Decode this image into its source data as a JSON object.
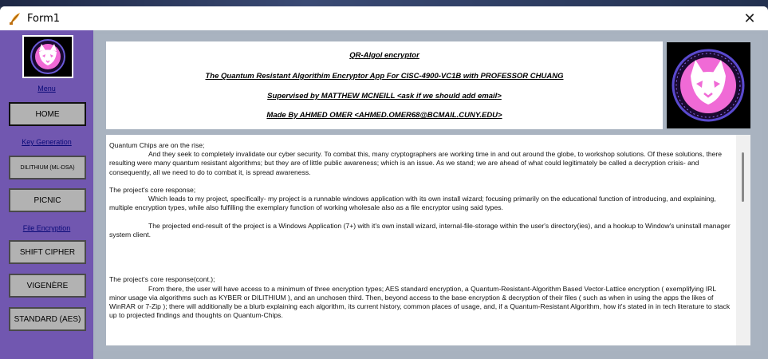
{
  "window": {
    "title": "Form1",
    "close_glyph": "✕"
  },
  "sidebar": {
    "menu_label": "Menu",
    "home_button": "HOME",
    "key_generation_label": "Key Generation",
    "dilithium_button": "DILITHIUM (ML-DSA)",
    "picnic_button": "PICNIC",
    "file_encryption_label": "File Encryption",
    "shift_cipher_button": "SHIFT CIPHER",
    "vigenere_button": "VIGENÈRE",
    "aes_button": "STANDARD (AES)"
  },
  "header": {
    "line1": "QR-Algol encryptor",
    "line2": "The Quantum Resistant Algorithim Encryptor App For CISC-4900-VC1B with PROFESSOR CHUANG",
    "line3": "Supervised by MATTHEW MCNEILL <ask if we should add email>",
    "line4": "Made By AHMED OMER <AHMED.OMER68@BCMAIL.CUNY.EDU>"
  },
  "content": {
    "p1_heading": "Quantum Chips are on the rise;",
    "p1_body": "And they seek to completely invalidate our cyber security. To combat this, many cryptographers are working time in and out around the globe, to workshop solutions. Of these solutions, there resulting were many quantum resistant algorithms; but they are of little public awareness; which is an issue. As we stand; we are ahead of what could legitimately be called a decryption crisis- and consequently, all we need to do to combat it, is spread awareness.",
    "p2_heading": "The project's core response;",
    "p2_body": "Which leads to my project, specifically- my project is a runnable windows application with its own install wizard; focusing primarily on the educational function of introducing, and explaining, multiple encryption types, while also fulfilling the exemplary function of working wholesale also as a file encryptor using said types.",
    "p3_body": "The projected end-result of the project is a Windows Application (7+) with it's own install wizard, internal-file-storage within the user's directory(ies), and a hookup to Window's uninstall manager system client.",
    "p4_heading": "The project's core response(cont.);",
    "p4_body": "From there, the user will have access to a minimum of three encryption types; AES standard encryption, a Quantum-Resistant-Algorithm Based Vector-Lattice encryption ( exemplifying IRL minor usage via algorithms such as KYBER or DILITHIUM ), and an unchosen third. Then, beyond access to the base encryption & decryption of their files ( such as when in using the apps the likes of WinRAR or 7-Zip ); there will additionally be a blurb explaining each algorithm, its current history, common places of usage, and, if a Quantum-Resistant Algorithm, how it's stated in in tech literature to stack up to projected findings and thoughts on Quantum-Chips."
  },
  "colors": {
    "sidebar_bg": "#7157b0",
    "panel_bg": "#a9b3c0",
    "logo_accent": "#f06ad6"
  },
  "icons": {
    "app_icon": "feather-app-icon",
    "logo": "cat-face-logo",
    "close": "close-icon"
  }
}
